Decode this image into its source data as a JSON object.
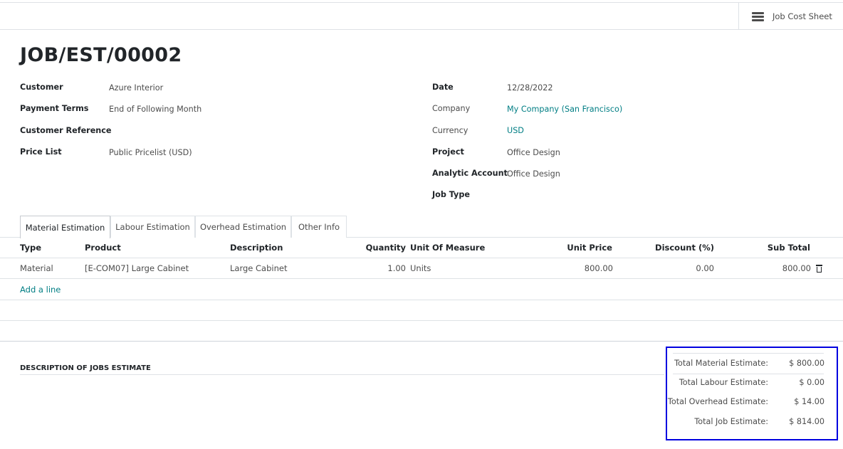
{
  "header": {
    "smart_button_label": "Job Cost Sheet"
  },
  "title": "JOB/EST/00002",
  "left_fields": {
    "customer_label": "Customer",
    "customer_value": "Azure Interior",
    "payment_terms_label": "Payment Terms",
    "payment_terms_value": "End of Following Month",
    "customer_reference_label": "Customer Reference",
    "price_list_label": "Price List",
    "price_list_value": "Public Pricelist (USD)"
  },
  "right_fields": {
    "date_label": "Date",
    "date_value": "12/28/2022",
    "company_label": "Company",
    "company_value": "My Company (San Francisco)",
    "currency_label": "Currency",
    "currency_value": "USD",
    "project_label": "Project",
    "project_value": "Office Design",
    "analytic_label": "Analytic Account",
    "analytic_value": "Office Design",
    "job_type_label": "Job Type"
  },
  "tabs": [
    "Material Estimation",
    "Labour Estimation",
    "Overhead Estimation",
    "Other Info"
  ],
  "table": {
    "headers": [
      "Type",
      "Product",
      "Description",
      "Quantity",
      "Unit Of Measure",
      "Unit Price",
      "Discount (%)",
      "Sub Total"
    ],
    "rows": [
      [
        "Material",
        "[E-COM07] Large Cabinet",
        "Large Cabinet",
        "1.00",
        "Units",
        "800.00",
        "0.00",
        "800.00"
      ]
    ],
    "add_line": "Add a line"
  },
  "description_title": "DESCRIPTION OF JOBS ESTIMATE",
  "totals": {
    "material_label": "Total Material Estimate:",
    "material_value": "$ 800.00",
    "labour_label": "Total Labour Estimate:",
    "labour_value": "$ 0.00",
    "overhead_label": "Total Overhead Estimate:",
    "overhead_value": "$ 14.00",
    "job_label": "Total Job Estimate:",
    "job_value": "$ 814.00"
  },
  "colors": {
    "link": "#017e84",
    "highlight_border": "#0000e0"
  }
}
